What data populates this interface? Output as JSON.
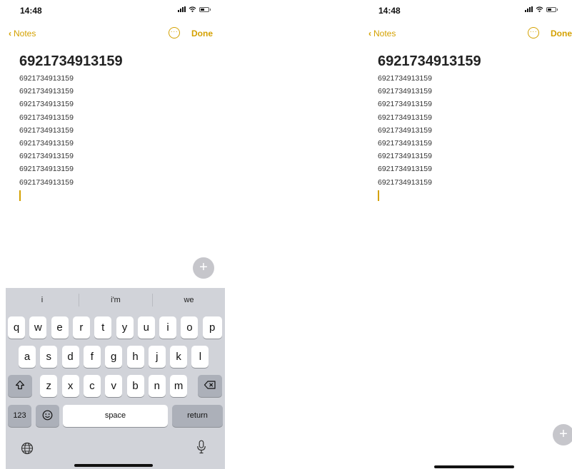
{
  "status": {
    "time": "14:48"
  },
  "nav": {
    "back_label": "Notes",
    "more_label": "···",
    "done_label": "Done"
  },
  "note": {
    "title": "6921734913159",
    "lines": [
      "6921734913159",
      "6921734913159",
      "6921734913159",
      "6921734913159",
      "6921734913159",
      "6921734913159",
      "6921734913159",
      "6921734913159",
      "6921734913159"
    ]
  },
  "add_button": {
    "label": "+"
  },
  "keyboard": {
    "suggestions": [
      "i",
      "i'm",
      "we"
    ],
    "row1": [
      "q",
      "w",
      "e",
      "r",
      "t",
      "y",
      "u",
      "i",
      "o",
      "p"
    ],
    "row2": [
      "a",
      "s",
      "d",
      "f",
      "g",
      "h",
      "j",
      "k",
      "l"
    ],
    "row3": [
      "z",
      "x",
      "c",
      "v",
      "b",
      "n",
      "m"
    ],
    "numbers_label": "123",
    "space_label": "space",
    "return_label": "return"
  },
  "colors": {
    "accent": "#d4a100",
    "keyboard_bg": "#d1d3d9",
    "key_bg": "#ffffff",
    "func_key_bg": "#acb0b9"
  }
}
